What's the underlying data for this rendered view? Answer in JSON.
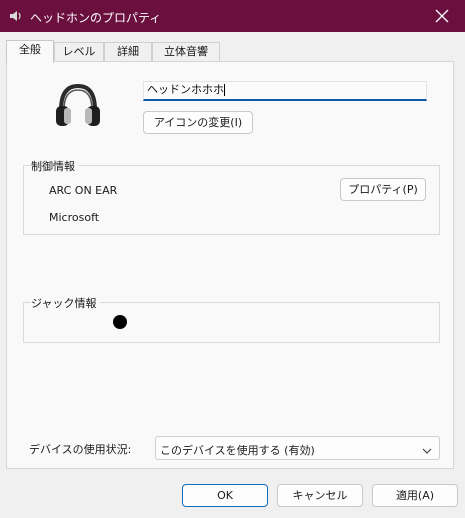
{
  "window": {
    "title": "ヘッドホンのプロパティ"
  },
  "tabs": [
    {
      "label": "全般",
      "active": true
    },
    {
      "label": "レベル",
      "active": false
    },
    {
      "label": "詳細",
      "active": false
    },
    {
      "label": "立体音響",
      "active": false
    }
  ],
  "general": {
    "device_name_value": "ヘッドンホホホ",
    "change_icon_label": "アイコンの変更(I)",
    "controller_group_label": "制御情報",
    "controller_name": "ARC ON EAR",
    "properties_label": "プロパティ(P)",
    "manufacturer": "Microsoft",
    "jack_group_label": "ジャック情報",
    "device_usage_label": "デバイスの使用状況:",
    "device_usage_value": "このデバイスを使用する (有効)"
  },
  "footer": {
    "ok_label": "OK",
    "cancel_label": "キャンセル",
    "apply_label": "適用(A)"
  },
  "colors": {
    "titlebar": "#6b0f3f",
    "accent": "#0f6cbd"
  }
}
